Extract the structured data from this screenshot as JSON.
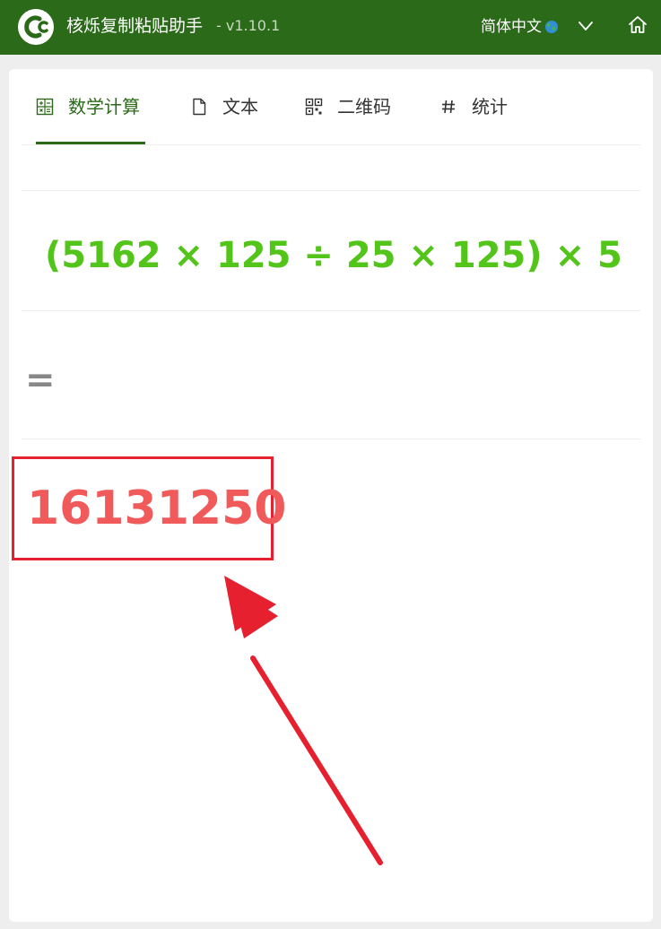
{
  "header": {
    "app_title": "核烁复制粘贴助手",
    "version": "- v1.10.1",
    "language": "简体中文",
    "icons": [
      "cc-logo-icon",
      "globe-icon",
      "chevron-down-icon",
      "home-icon"
    ]
  },
  "tabs": [
    {
      "label": "数学计算",
      "icon": "calculator-icon",
      "active": true
    },
    {
      "label": "文本",
      "icon": "document-icon",
      "active": false
    },
    {
      "label": "二维码",
      "icon": "qrcode-icon",
      "active": false
    },
    {
      "label": "统计",
      "icon": "hash-icon",
      "active": false
    }
  ],
  "calc": {
    "expression": "(5162 × 125 ÷ 25 × 125) × 5",
    "equals": "=",
    "result": "16131250"
  },
  "colors": {
    "header_bg": "#2a6a18",
    "expression": "#52c41a",
    "result": "#f05a5a",
    "highlight": "#e6202e"
  }
}
